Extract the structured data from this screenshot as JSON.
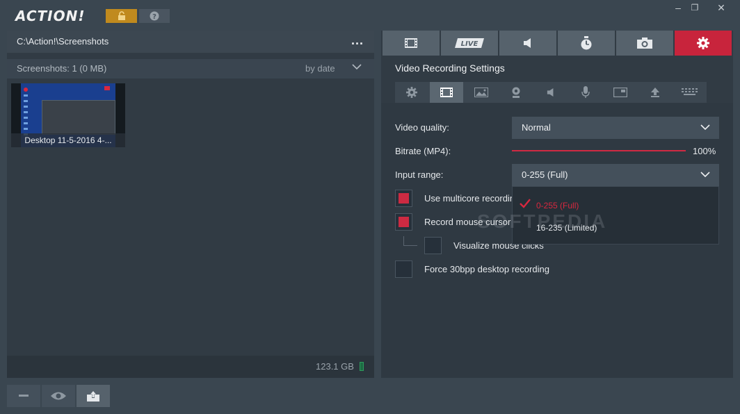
{
  "app": {
    "logo_text": "ACTION!",
    "window_controls": {
      "minimize": "–",
      "restore": "❐",
      "close": "✕"
    }
  },
  "left": {
    "path": "C:\\Action!\\Screenshots",
    "more": "...",
    "screenshots_count": "Screenshots: 1 (0 MB)",
    "sort_label": "by date",
    "thumbnail_caption": "Desktop 11-5-2016 4-...",
    "disk_free": "123.1 GB"
  },
  "right": {
    "section_title": "Video Recording Settings",
    "main_tabs": [
      {
        "name": "video",
        "icon": "film-icon"
      },
      {
        "name": "live",
        "label": "LIVE",
        "icon": "live-icon"
      },
      {
        "name": "audio",
        "icon": "speaker-icon"
      },
      {
        "name": "benchmark",
        "icon": "stopwatch-icon"
      },
      {
        "name": "screenshot",
        "icon": "camera-icon"
      },
      {
        "name": "settings",
        "icon": "gear-icon",
        "active": true
      }
    ],
    "sub_tabs_active": "video",
    "video_quality": {
      "label": "Video quality:",
      "value": "Normal"
    },
    "bitrate": {
      "label": "Bitrate (MP4):",
      "value_text": "100%",
      "level": 1.0
    },
    "input_range": {
      "label": "Input range:",
      "value": "0-255 (Full)",
      "options": [
        "0-255 (Full)",
        "16-235 (Limited)"
      ],
      "selected_index": 0
    },
    "checks": [
      {
        "label": "Use multicore recording",
        "checked": true
      },
      {
        "label": "Record mouse cursor",
        "checked": true
      },
      {
        "label": "Visualize mouse clicks",
        "checked": false
      },
      {
        "label": "Force 30bpp desktop recording",
        "checked": false
      }
    ],
    "watermark": "SOFTPEDIA"
  },
  "colors": {
    "accent": "#c8243c",
    "lock": "#c08a1e",
    "panel": "#313b44"
  }
}
